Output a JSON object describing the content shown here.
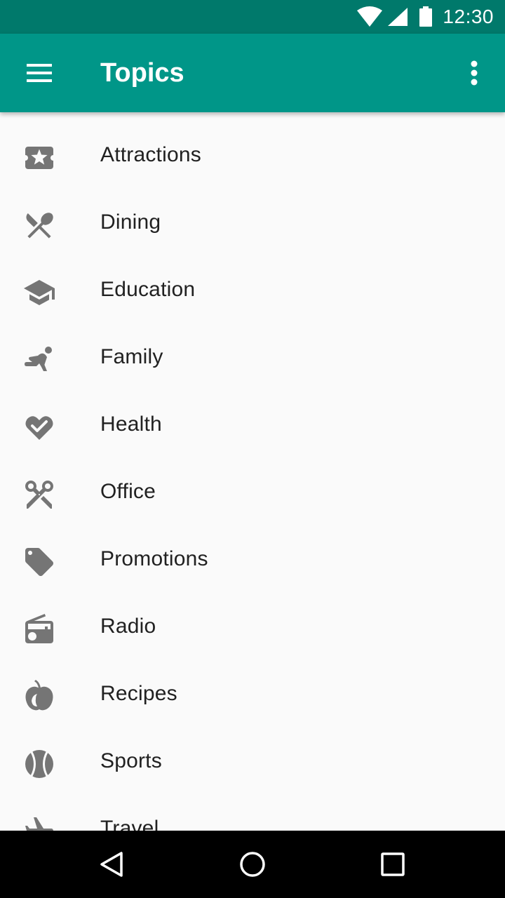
{
  "status_bar": {
    "time": "12:30",
    "icons": [
      "wifi-icon",
      "cellular-signal-icon",
      "battery-icon"
    ],
    "background": "#00796b"
  },
  "app_bar": {
    "title": "Topics",
    "background": "#009688",
    "left_icon": "hamburger-menu-icon",
    "right_icon": "more-vert-icon"
  },
  "topics": [
    {
      "label": "Attractions",
      "icon": "ticket-star-icon"
    },
    {
      "label": "Dining",
      "icon": "restaurant-icon"
    },
    {
      "label": "Education",
      "icon": "graduation-cap-icon"
    },
    {
      "label": "Family",
      "icon": "child-play-icon"
    },
    {
      "label": "Health",
      "icon": "heart-check-icon"
    },
    {
      "label": "Office",
      "icon": "scissors-icon"
    },
    {
      "label": "Promotions",
      "icon": "tag-icon"
    },
    {
      "label": "Radio",
      "icon": "radio-icon"
    },
    {
      "label": "Recipes",
      "icon": "apple-icon"
    },
    {
      "label": "Sports",
      "icon": "tennis-ball-icon"
    },
    {
      "label": "Travel",
      "icon": "airplane-icon"
    }
  ],
  "nav_bar": {
    "buttons": [
      "back-icon",
      "home-icon",
      "recents-icon"
    ]
  },
  "colors": {
    "icon_gray": "#757575",
    "text": "#212121",
    "list_background": "#fafafa"
  }
}
